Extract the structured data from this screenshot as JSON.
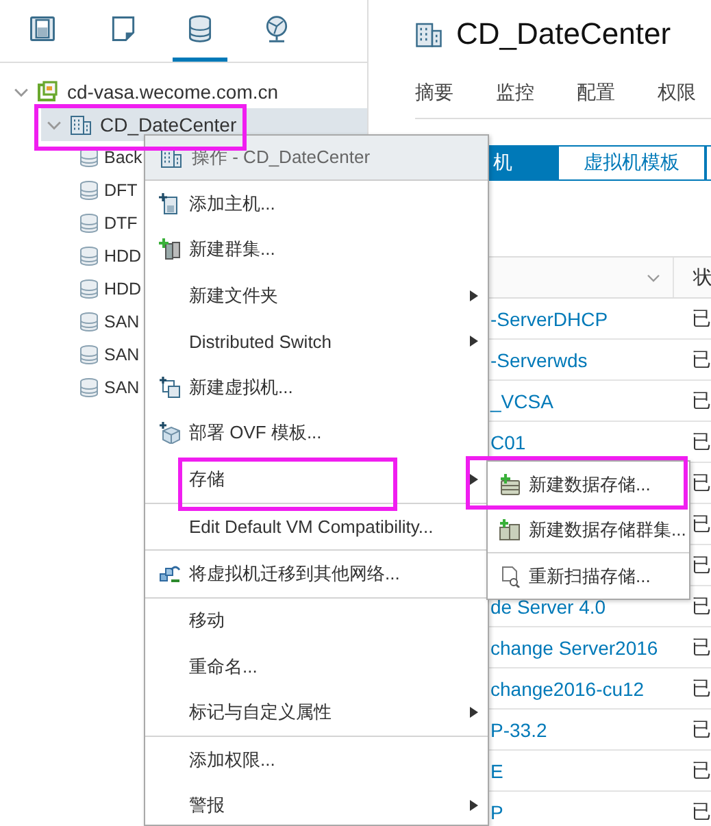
{
  "nav_tabs": [
    {
      "kind": "hosts",
      "selected": false
    },
    {
      "kind": "vms",
      "selected": false
    },
    {
      "kind": "storage",
      "selected": true
    },
    {
      "kind": "network",
      "selected": false
    }
  ],
  "tree": [
    {
      "label": "cd-vasa.wecome.com.cn",
      "kind": "vcenter",
      "expanded": true,
      "selected": false,
      "children": [
        {
          "label": "CD_DateCenter",
          "kind": "datacenter",
          "expanded": true,
          "selected": true,
          "highlighted": true,
          "children": [
            {
              "label": "Back",
              "kind": "datastore"
            },
            {
              "label": "DFT",
              "kind": "datastore"
            },
            {
              "label": "DTF",
              "kind": "datastore"
            },
            {
              "label": "HDD",
              "kind": "datastore"
            },
            {
              "label": "HDD",
              "kind": "datastore"
            },
            {
              "label": "SAN",
              "kind": "datastore"
            },
            {
              "label": "SAN",
              "kind": "datastore"
            },
            {
              "label": "SAN",
              "kind": "datastore"
            }
          ]
        }
      ]
    }
  ],
  "header": {
    "title": "CD_DateCenter",
    "tabs": [
      {
        "label": "摘要",
        "selected": false
      },
      {
        "label": "监控",
        "selected": false
      },
      {
        "label": "配置",
        "selected": false
      },
      {
        "label": "权限",
        "selected": false
      }
    ]
  },
  "subtabs": [
    {
      "label": "机",
      "selected": true
    },
    {
      "label": "虚拟机模板",
      "selected": false
    }
  ],
  "table": {
    "column_2": "状",
    "rows": [
      {
        "column_1": "-ServerDHCP",
        "column_2": "已"
      },
      {
        "column_1": "-Serverwds",
        "column_2": "已"
      },
      {
        "column_1": "_VCSA",
        "column_2": "已"
      },
      {
        "column_1": "C01",
        "column_2": "已"
      },
      {
        "column_2": "已"
      },
      {
        "column_2": "已"
      },
      {
        "column_2": "已"
      },
      {
        "column_1": "de Server 4.0",
        "column_2": "已"
      },
      {
        "column_1": "change Server2016",
        "column_2": "已"
      },
      {
        "column_1": "change2016-cu12",
        "column_2": "已"
      },
      {
        "column_1": "P-33.2",
        "column_2": "已"
      },
      {
        "column_1": "E",
        "column_2": "已"
      },
      {
        "column_1": "P",
        "column_2": "已"
      }
    ]
  },
  "context_menu": {
    "title": "操作 - CD_DateCenter",
    "items": [
      {
        "label": "添加主机...",
        "kind": "add-host",
        "submenu": false,
        "separator_before": false,
        "highlighted": false
      },
      {
        "label": "新建群集...",
        "kind": "new-cluster",
        "submenu": false,
        "separator_before": false,
        "highlighted": false
      },
      {
        "label": "新建文件夹",
        "kind": "plain",
        "submenu": true,
        "separator_before": false,
        "highlighted": false
      },
      {
        "label": "Distributed Switch",
        "kind": "plain",
        "submenu": true,
        "separator_before": false,
        "highlighted": false
      },
      {
        "label": "新建虚拟机...",
        "kind": "new-vm",
        "submenu": false,
        "separator_before": false,
        "highlighted": false
      },
      {
        "label": "部署 OVF 模板...",
        "kind": "deploy-ovf",
        "submenu": false,
        "separator_before": false,
        "highlighted": false
      },
      {
        "label": "存储",
        "kind": "plain",
        "submenu": true,
        "separator_before": false,
        "highlighted": true
      },
      {
        "label": "Edit Default VM Compatibility...",
        "kind": "plain",
        "submenu": false,
        "separator_before": true,
        "highlighted": false
      },
      {
        "label": "将虚拟机迁移到其他网络...",
        "kind": "migrate",
        "submenu": false,
        "separator_before": true,
        "highlighted": false
      },
      {
        "label": "移动",
        "kind": "plain",
        "submenu": false,
        "separator_before": true,
        "highlighted": false
      },
      {
        "label": "重命名...",
        "kind": "plain",
        "submenu": false,
        "separator_before": false,
        "highlighted": false
      },
      {
        "label": "标记与自定义属性",
        "kind": "plain",
        "submenu": true,
        "separator_before": false,
        "highlighted": false
      },
      {
        "label": "添加权限...",
        "kind": "plain",
        "submenu": false,
        "separator_before": true,
        "highlighted": false
      },
      {
        "label": "警报",
        "kind": "plain",
        "submenu": true,
        "separator_before": false,
        "highlighted": false
      }
    ]
  },
  "submenu": {
    "items": [
      {
        "label": "新建数据存储...",
        "kind": "new-datastore",
        "separator_before": false,
        "highlighted": true
      },
      {
        "label": "新建数据存储群集...",
        "kind": "new-datastore-cluster",
        "separator_before": false,
        "highlighted": false
      },
      {
        "label": "重新扫描存储...",
        "kind": "rescan",
        "separator_before": true,
        "highlighted": false
      }
    ]
  }
}
